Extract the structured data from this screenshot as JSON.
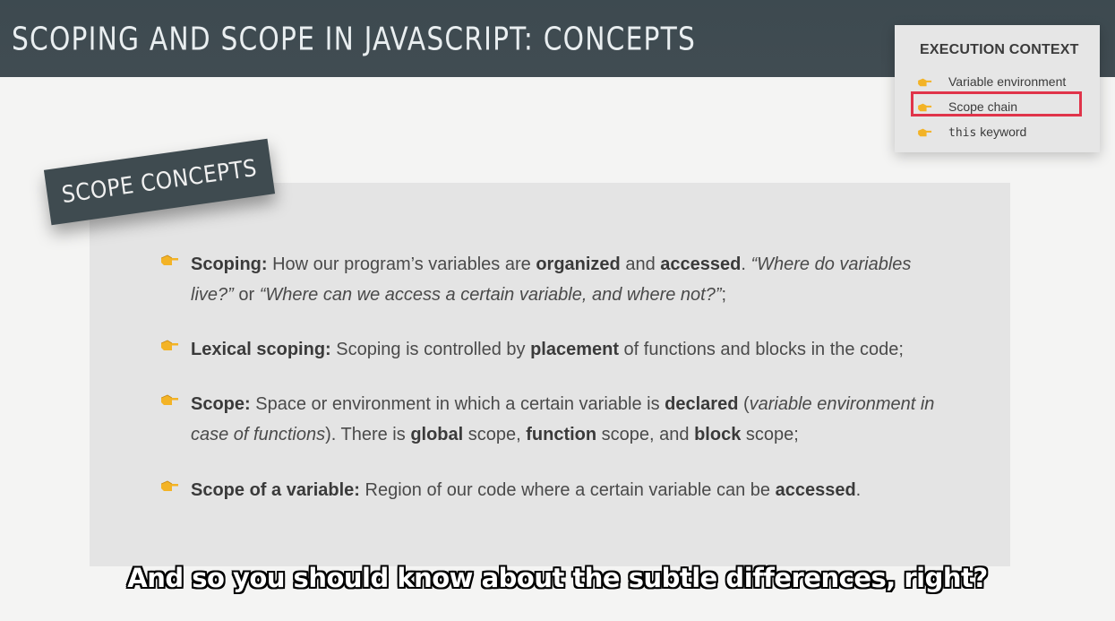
{
  "header": {
    "title": "Scoping and Scope in JavaScript: Concepts"
  },
  "label": {
    "text": "Scope concepts"
  },
  "colors": {
    "header_bg": "#414c52",
    "highlight": "#e0344a",
    "hand": "#f3b326"
  },
  "bullets": [
    {
      "icon": "pointing-hand-icon",
      "term": "Scoping:",
      "parts": [
        {
          "t": " How our program’s variables are "
        },
        {
          "t": "organized",
          "b": true
        },
        {
          "t": " and "
        },
        {
          "t": "accessed",
          "b": true
        },
        {
          "t": ". "
        },
        {
          "t": "“Where do variables live?”",
          "i": true
        },
        {
          "t": " or "
        },
        {
          "t": "“Where can we access a certain variable, and where not?”",
          "i": true
        },
        {
          "t": ";"
        }
      ]
    },
    {
      "icon": "pointing-hand-icon",
      "term": "Lexical scoping:",
      "parts": [
        {
          "t": " Scoping is controlled by "
        },
        {
          "t": "placement",
          "b": true
        },
        {
          "t": " of functions and blocks in the code;"
        }
      ]
    },
    {
      "icon": "pointing-hand-icon",
      "term": "Scope:",
      "parts": [
        {
          "t": " Space or environment in which a certain variable is "
        },
        {
          "t": "declared",
          "b": true
        },
        {
          "t": " ("
        },
        {
          "t": "variable environment in case of functions",
          "i": true
        },
        {
          "t": "). There is "
        },
        {
          "t": "global",
          "b": true
        },
        {
          "t": " scope, "
        },
        {
          "t": "function",
          "b": true
        },
        {
          "t": " scope, and "
        },
        {
          "t": "block",
          "b": true
        },
        {
          "t": " scope;"
        }
      ]
    },
    {
      "icon": "pointing-hand-icon",
      "term": "Scope of a variable:",
      "parts": [
        {
          "t": " Region of our code where a certain variable can be "
        },
        {
          "t": "accessed",
          "b": true
        },
        {
          "t": "."
        }
      ]
    }
  ],
  "execution_context": {
    "title": "EXECUTION CONTEXT",
    "items": [
      {
        "label": "Variable environment",
        "highlighted": false
      },
      {
        "label": "Scope chain",
        "highlighted": true
      },
      {
        "code": "this",
        "label": " keyword",
        "highlighted": false
      }
    ]
  },
  "subtitle": "And so you should know about the subtle differences, right?"
}
